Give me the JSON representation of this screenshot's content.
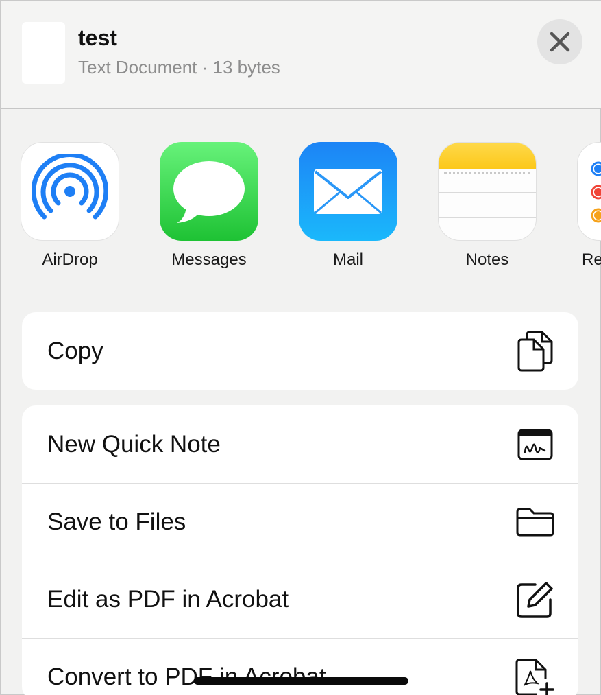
{
  "file": {
    "name": "test",
    "details": "Text Document · 13 bytes"
  },
  "header": {
    "close_icon": "close-icon"
  },
  "apps": [
    {
      "label": "AirDrop",
      "icon": "airdrop-icon"
    },
    {
      "label": "Messages",
      "icon": "messages-icon"
    },
    {
      "label": "Mail",
      "icon": "mail-icon"
    },
    {
      "label": "Notes",
      "icon": "notes-icon"
    },
    {
      "label": "Re",
      "icon": "reminders-icon"
    }
  ],
  "actions_group1": [
    {
      "label": "Copy",
      "icon": "copy-icon"
    }
  ],
  "actions_group2": [
    {
      "label": "New Quick Note",
      "icon": "quick-note-icon"
    },
    {
      "label": "Save to Files",
      "icon": "folder-icon"
    },
    {
      "label": "Edit as PDF in Acrobat",
      "icon": "edit-pdf-icon"
    },
    {
      "label": "Convert to PDF in Acrobat",
      "icon": "convert-pdf-icon"
    }
  ],
  "colors": {
    "airdrop_blue": "#1e7ff5",
    "messages_green": "#2ec83f",
    "mail_blue": "#1c95f8",
    "notes_yellow": "#fdd12f"
  }
}
